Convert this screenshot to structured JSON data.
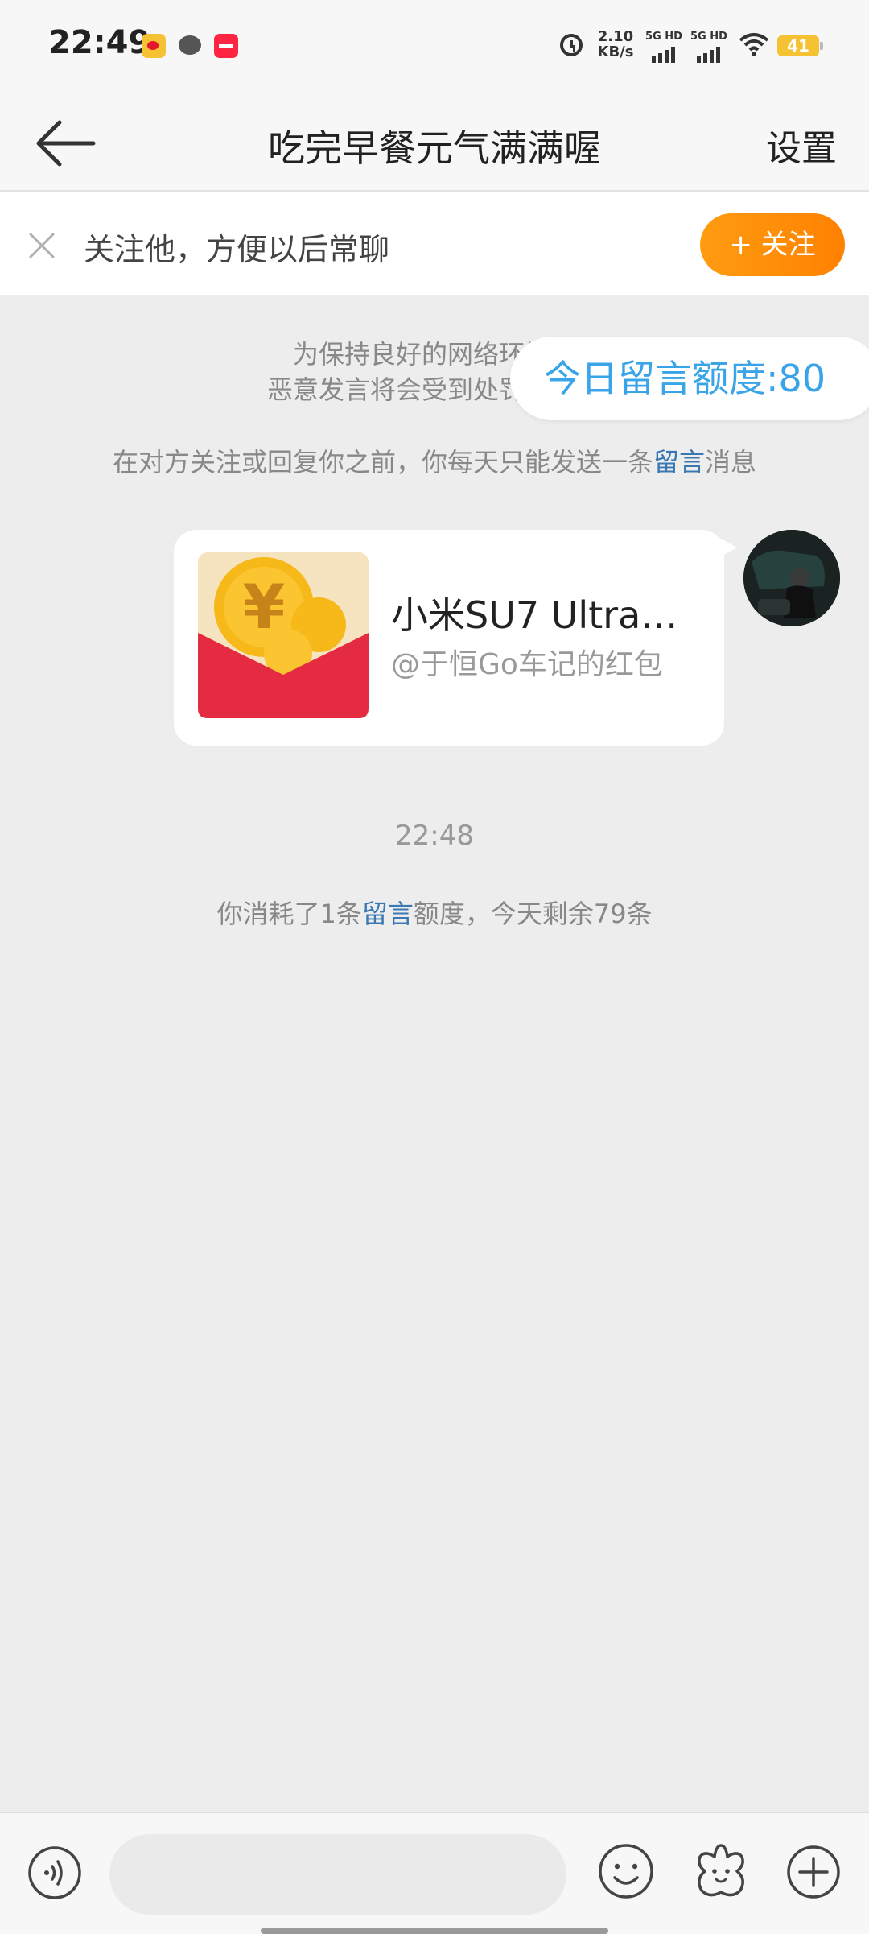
{
  "status_bar": {
    "time": "22:49",
    "net_speed_value": "2.10",
    "net_speed_unit": "KB/s",
    "sim1": "5G HD",
    "sim2": "5G HD",
    "battery": "41"
  },
  "nav": {
    "title": "吃完早餐元气满满喔",
    "settings_label": "设置"
  },
  "follow_banner": {
    "prompt": "关注他，方便以后常聊",
    "button_label": "+ 关注"
  },
  "notices": {
    "line1": "为保持良好的网络环境，",
    "line2": "恶意发言将会受到处罚，详细",
    "line3_before": "在对方关注或回复你之前，你每天只能发送一条",
    "line3_link": "留言",
    "line3_after": "消息"
  },
  "quota_badge": "今日留言额度:80",
  "message": {
    "title": "小米SU7 Ultra…",
    "source": "@于恒Go车记的红包"
  },
  "message_time": "22:48",
  "quota_consumed": {
    "before": "你消耗了1条",
    "link": "留言",
    "after": "额度，今天剩余79条"
  },
  "input": {
    "placeholder": ""
  },
  "colors": {
    "accent_orange": "#ff8f0a",
    "link_blue": "#3a78b3",
    "badge_blue": "#3aa4e8",
    "redpacket_red": "#e52b41",
    "coin_gold": "#f7b81a"
  }
}
